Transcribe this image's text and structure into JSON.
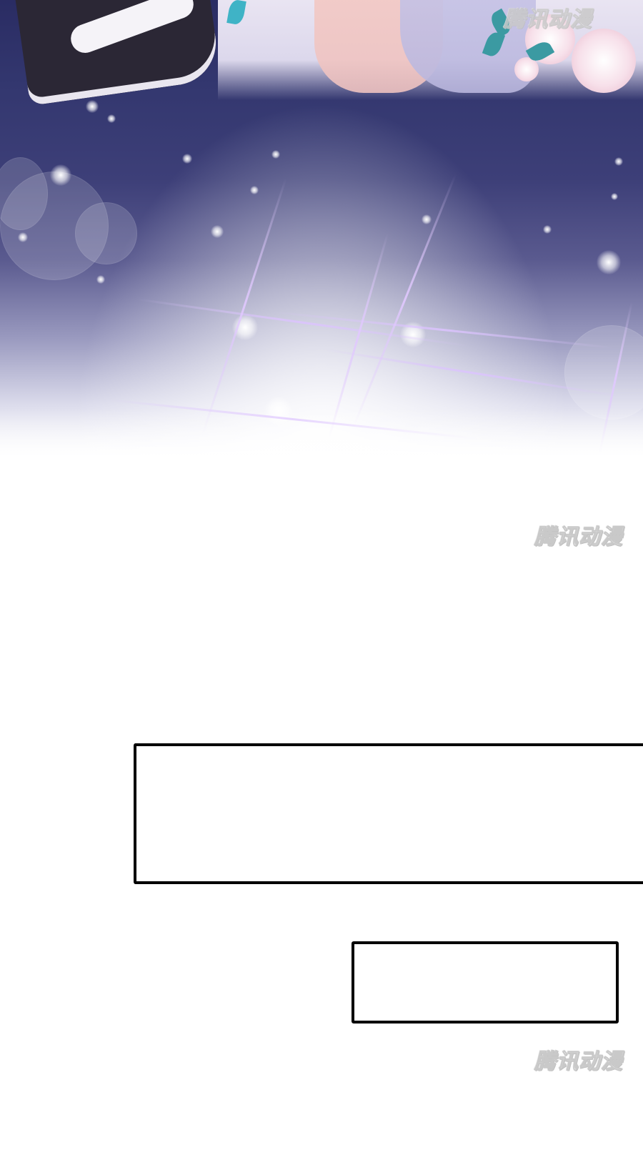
{
  "watermark": {
    "text": "腾讯动漫"
  },
  "panels": {
    "top_panel": "illustration",
    "caption_box_1": "",
    "caption_box_2": ""
  },
  "colors": {
    "night_sky": "#33376f",
    "sparkle": "#dcc3ff",
    "box_border": "#000000",
    "background": "#ffffff"
  }
}
